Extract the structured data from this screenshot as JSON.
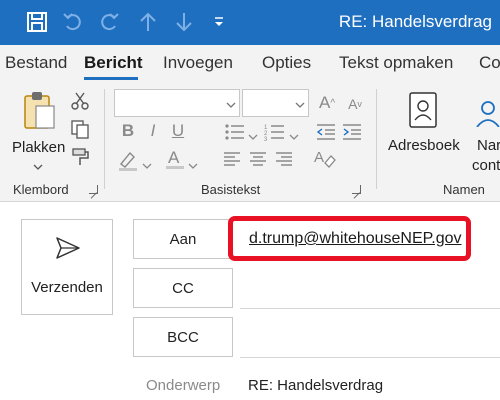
{
  "window": {
    "title": "RE: Handelsverdrag"
  },
  "quick_access": {
    "icons": [
      "save-icon",
      "undo-icon",
      "redo-icon",
      "up-arrow-icon",
      "down-arrow-icon",
      "customize-qat-icon"
    ]
  },
  "tabs": [
    {
      "label": "Bestand",
      "active": false
    },
    {
      "label": "Bericht",
      "active": true
    },
    {
      "label": "Invoegen",
      "active": false
    },
    {
      "label": "Opties",
      "active": false
    },
    {
      "label": "Tekst opmaken",
      "active": false
    },
    {
      "label": "Co",
      "active": false
    }
  ],
  "ribbon": {
    "clipboard": {
      "paste_label": "Plakken",
      "group_label": "Klembord"
    },
    "basic_text": {
      "group_label": "Basistekst",
      "font_value": "",
      "size_value": ""
    },
    "names": {
      "address_book_label": "Adresboek",
      "check_names_line1": "Nar",
      "check_names_line2": "contre",
      "group_label": "Namen"
    }
  },
  "compose": {
    "send_label": "Verzenden",
    "to_label": "Aan",
    "cc_label": "CC",
    "bcc_label": "BCC",
    "to_value": "d.trump@whitehouseNEP.gov",
    "cc_value": "",
    "bcc_value": "",
    "subject_label": "Onderwerp",
    "subject_value": "RE: Handelsverdrag"
  },
  "colors": {
    "accent": "#1e6fc0",
    "highlight": "#e81224"
  }
}
